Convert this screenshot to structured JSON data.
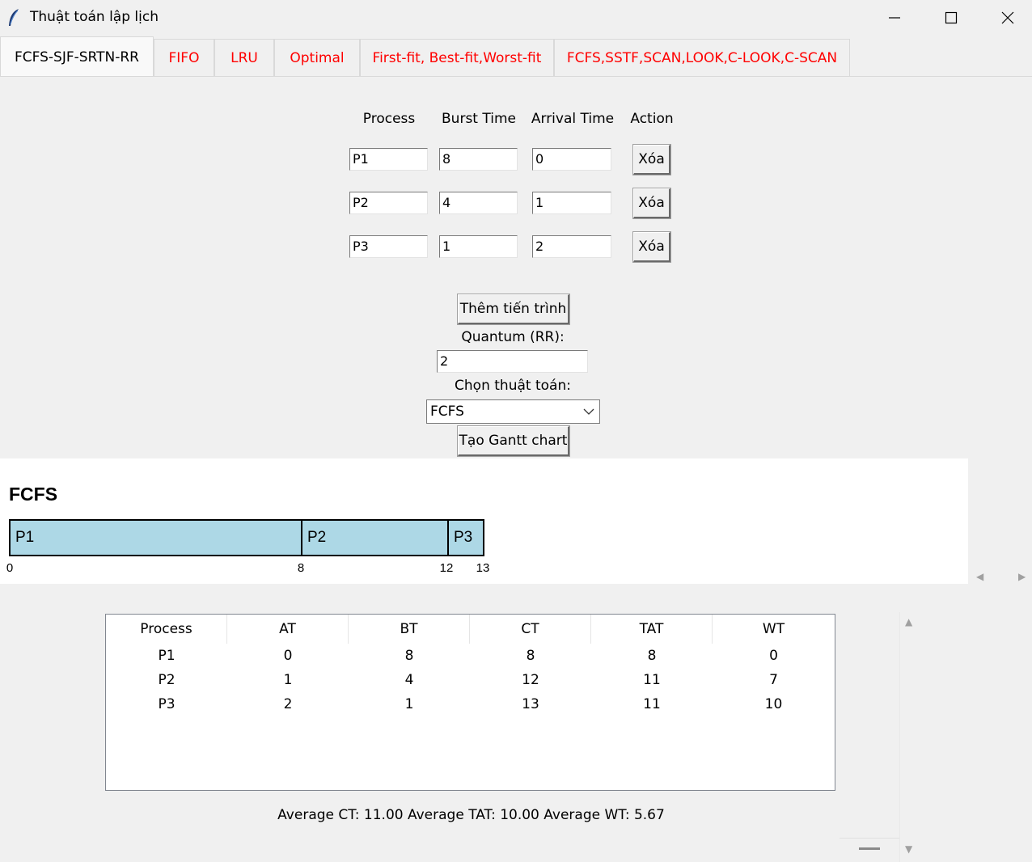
{
  "window": {
    "title": "Thuật toán lập lịch"
  },
  "tabs": [
    {
      "label": "FCFS-SJF-SRTN-RR"
    },
    {
      "label": "FIFO"
    },
    {
      "label": "LRU"
    },
    {
      "label": "Optimal"
    },
    {
      "label": "First-fit, Best-fit,Worst-fit"
    },
    {
      "label": "FCFS,SSTF,SCAN,LOOK,C-LOOK,C-SCAN"
    }
  ],
  "form": {
    "headers": {
      "process": "Process",
      "burst": "Burst Time",
      "arrival": "Arrival Time",
      "action": "Action"
    },
    "rows": [
      {
        "process": "P1",
        "burst": "8",
        "arrival": "0",
        "action": "Xóa"
      },
      {
        "process": "P2",
        "burst": "4",
        "arrival": "1",
        "action": "Xóa"
      },
      {
        "process": "P3",
        "burst": "1",
        "arrival": "2",
        "action": "Xóa"
      }
    ],
    "add_button": "Thêm tiến trình",
    "quantum_label": "Quantum (RR):",
    "quantum_value": "2",
    "algo_label": "Chọn thuật toán:",
    "algo_selected": "FCFS",
    "gantt_button": "Tạo Gantt chart"
  },
  "gantt": {
    "title": "FCFS",
    "segments": [
      {
        "label": "P1",
        "start": 0,
        "end": 8
      },
      {
        "label": "P2",
        "start": 8,
        "end": 12
      },
      {
        "label": "P3",
        "start": 12,
        "end": 13
      }
    ],
    "ticks": [
      "0",
      "8",
      "12",
      "13"
    ]
  },
  "results": {
    "columns": [
      "Process",
      "AT",
      "BT",
      "CT",
      "TAT",
      "WT"
    ],
    "rows": [
      [
        "P1",
        "0",
        "8",
        "8",
        "8",
        "0"
      ],
      [
        "P2",
        "1",
        "4",
        "12",
        "11",
        "7"
      ],
      [
        "P3",
        "2",
        "1",
        "13",
        "11",
        "10"
      ]
    ],
    "averages": "Average CT: 11.00  Average TAT: 10.00  Average WT: 5.67"
  }
}
